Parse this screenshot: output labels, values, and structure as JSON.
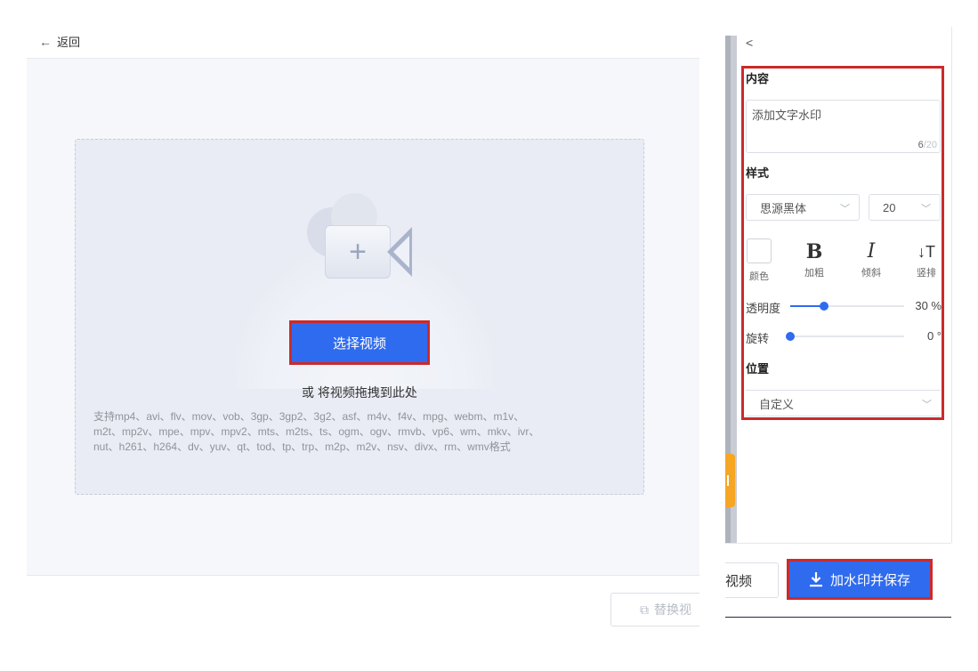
{
  "header": {
    "back_arrow": "←",
    "back_label": "返回"
  },
  "upload": {
    "select_label": "选择视频",
    "drag_hint": "或 将视频拖拽到此处",
    "formats_line1": "支持mp4、avi、flv、mov、vob、3gp、3gp2、3g2、asf、m4v、f4v、mpg、webm、m1v、",
    "formats_line2": "m2t、mp2v、mpe、mpv、mpv2、mts、m2ts、ts、ogm、ogv、rmvb、vp6、wm、mkv、ivr、",
    "formats_line3": "nut、h261、h264、dv、yuv、qt、tod、tp、trp、m2p、m2v、nsv、divx、rm、wmv格式",
    "plus": "+"
  },
  "bottom": {
    "replace_label": "替换视"
  },
  "panel": {
    "back": "<",
    "content_title": "内容",
    "text_value": "添加文字水印",
    "count_current": "6",
    "count_max": "/20",
    "style_title": "样式",
    "font_value": "思源黑体",
    "size_value": "20",
    "chevron": "﹀",
    "color_label": "颜色",
    "bold_glyph": "B",
    "bold_label": "加粗",
    "italic_glyph": "I",
    "italic_label": "倾斜",
    "vertical_glyph": "↓T",
    "vertical_label": "竖排",
    "opacity_label": "透明度",
    "opacity_value": "30 %",
    "opacity_level": 0.3,
    "rotate_label": "旋转",
    "rotate_value": "0 °",
    "rotate_level": 0,
    "position_title": "位置",
    "position_value": "自定义"
  },
  "footer": {
    "prev_label": "视频",
    "save_label": "加水印并保存"
  },
  "colors": {
    "accent": "#2f6bef",
    "highlight": "#cc2a2a",
    "orange": "#f5a623"
  }
}
